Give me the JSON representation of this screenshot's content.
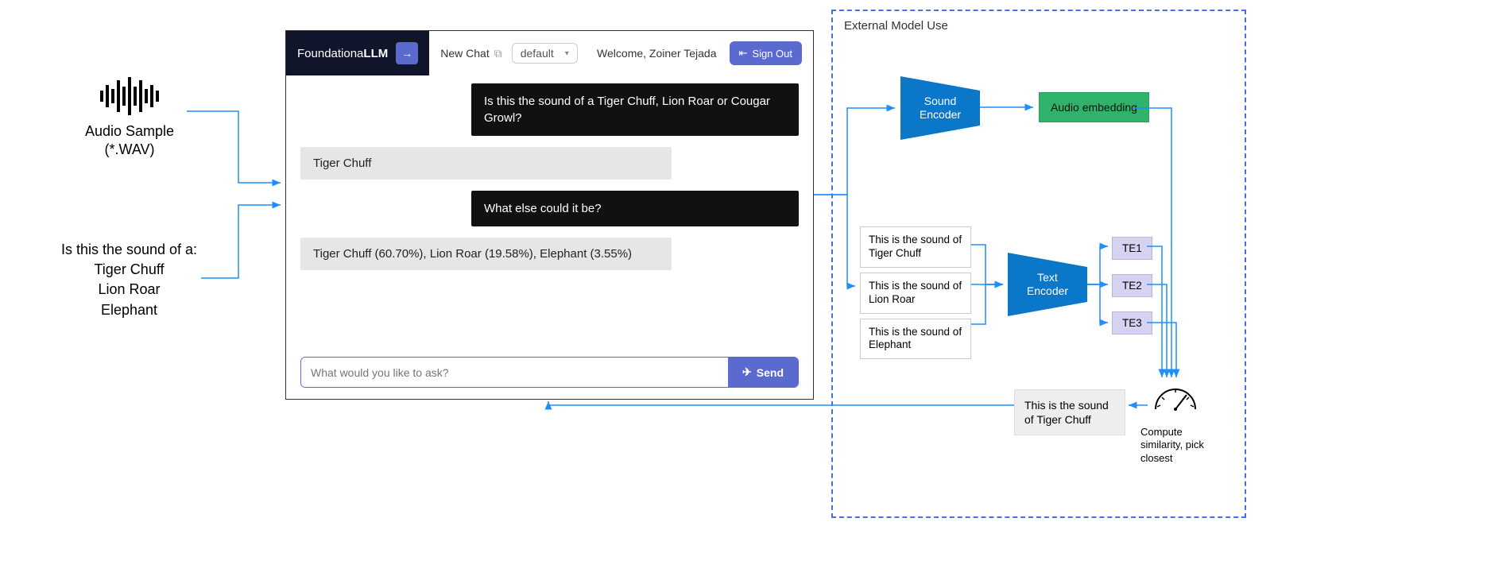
{
  "left": {
    "audio_label_line1": "Audio Sample",
    "audio_label_line2": "(*.WAV)",
    "prompt_intro": "Is this the sound of a:",
    "prompt_opts": [
      "Tiger Chuff",
      "Lion Roar",
      "Elephant"
    ]
  },
  "chat": {
    "brand_prefix": "Foundationa",
    "brand_suffix": "LLM",
    "new_chat": "New Chat",
    "select_value": "default",
    "welcome": "Welcome, Zoiner Tejada",
    "signout": "Sign Out",
    "messages": {
      "u1": "Is this the sound of a Tiger Chuff, Lion Roar or Cougar Growl?",
      "a1": "Tiger Chuff",
      "u2": "What else could it be?",
      "a2": "Tiger Chuff (60.70%), Lion Roar (19.58%), Elephant (3.55%)"
    },
    "input_placeholder": "What would you like to ask?",
    "send": "Send"
  },
  "ext": {
    "title": "External Model Use",
    "sound_encoder": "Sound Encoder",
    "text_encoder": "Text Encoder",
    "audio_embedding": "Audio embedding",
    "text_opts": [
      "This is the sound of Tiger Chuff",
      "This is the sound of Lion Roar",
      "This is the sound of Elephant"
    ],
    "te": [
      "TE1",
      "TE2",
      "TE3"
    ],
    "result": "This is the sound of Tiger Chuff",
    "similarity": "Compute similarity, pick closest"
  }
}
